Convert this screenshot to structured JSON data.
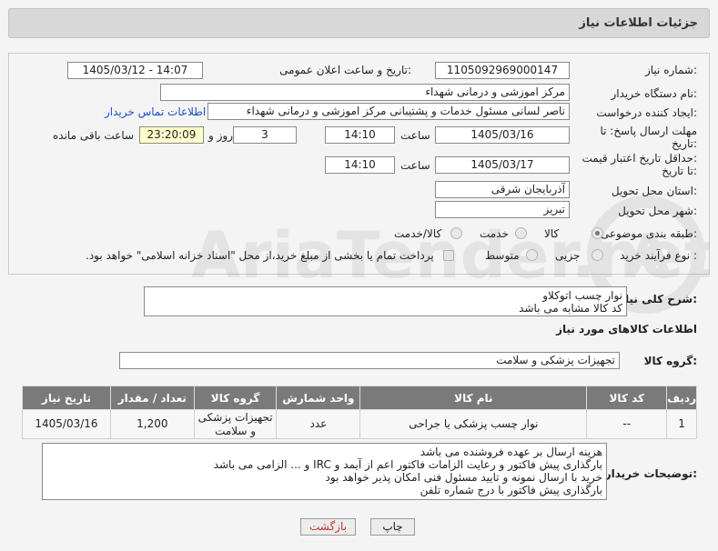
{
  "header": {
    "title": "جزئیات اطلاعات نیاز"
  },
  "form": {
    "need_number": {
      "label": "شماره نیاز:",
      "value": "1105092969000147"
    },
    "announce": {
      "label": "تاریخ و ساعت اعلان عمومی:",
      "value": "1405/03/12 - 14:07"
    },
    "buyer_org": {
      "label": "نام دستگاه خریدار:",
      "value": "مرکز اموزشی و درمانی شهداء"
    },
    "requester": {
      "label": "ایجاد کننده درخواست:",
      "value": "ناصر لسانی مسئول خدمات و پشتیبانی مرکز اموزشی و درمانی شهداء",
      "contact_link": "اطلاعات تماس خریدار"
    },
    "reply_deadline": {
      "label_line1": "مهلت ارسال پاسخ: تا",
      "label_line2": "تاریخ:",
      "date": "1405/03/16",
      "time_label": "ساعت",
      "time": "14:10",
      "days": "3",
      "days_label": "روز و",
      "remaining": "23:20:09",
      "remaining_label": "ساعت باقی مانده"
    },
    "price_validity": {
      "label_line1": "حداقل تاریخ اعتبار قیمت:",
      "label_line2": "تا تاریخ:",
      "date": "1405/03/17",
      "time_label": "ساعت",
      "time": "14:10"
    },
    "province": {
      "label": "استان محل تحویل:",
      "value": "آذربایجان شرقی"
    },
    "city": {
      "label": "شهر محل تحویل:",
      "value": "تبریز"
    },
    "category": {
      "label": "طبقه بندی موضوعی:",
      "options": [
        "کالا",
        "خدمت",
        "کالا/خدمت"
      ],
      "selected": "کالا"
    },
    "process": {
      "label": "نوع فرآیند خرید :",
      "options": [
        "جزیی",
        "متوسط"
      ],
      "note": "پرداخت تمام یا بخشی از مبلغ خرید،از محل \"اسناد خزانه اسلامی\" خواهد بود."
    }
  },
  "summary": {
    "label": "شرح کلی نیاز:",
    "text": "نوار چسب اتوکلاو\nکد کالا مشابه می باشد"
  },
  "goods_info": {
    "title": "اطلاعات کالاهای مورد نیاز"
  },
  "goods_group": {
    "label": "گروه کالا:",
    "value": "تجهیزات پزشکی و سلامت"
  },
  "table": {
    "headers": [
      "ردیف",
      "کد کالا",
      "نام کالا",
      "واحد شمارش",
      "گروه کالا",
      "تعداد / مقدار",
      "تاریخ نیاز"
    ],
    "rows": [
      [
        "1",
        "--",
        "نوار چسب پزشکی یا جراحی",
        "عدد",
        "تجهیزات پزشکی و سلامت",
        "1,200",
        "1405/03/16"
      ]
    ]
  },
  "buyer_notes": {
    "label": "توضیحات خریدار:",
    "text": "هزینه ارسال بر عهده فروشنده می باشد\nبارگذاری پیش فاکتور و رعایت الزامات فاکتور اعم از آیمد و IRC و ... الزامی می باشد\nخرید با ارسال نمونه و تایید مسئول فنی امکان پذیر خواهد بود\nبارگذاری پیش فاکتور با درج شماره تلفن"
  },
  "buttons": {
    "print": "چاپ",
    "back": "بازگشت"
  },
  "watermark": {
    "text": "AriaTender.net"
  },
  "colors": {
    "link": "#1a4fc4",
    "back_text": "#c0392b",
    "yellow_field": "#ffffcc",
    "table_header": "#7a7a7a"
  }
}
